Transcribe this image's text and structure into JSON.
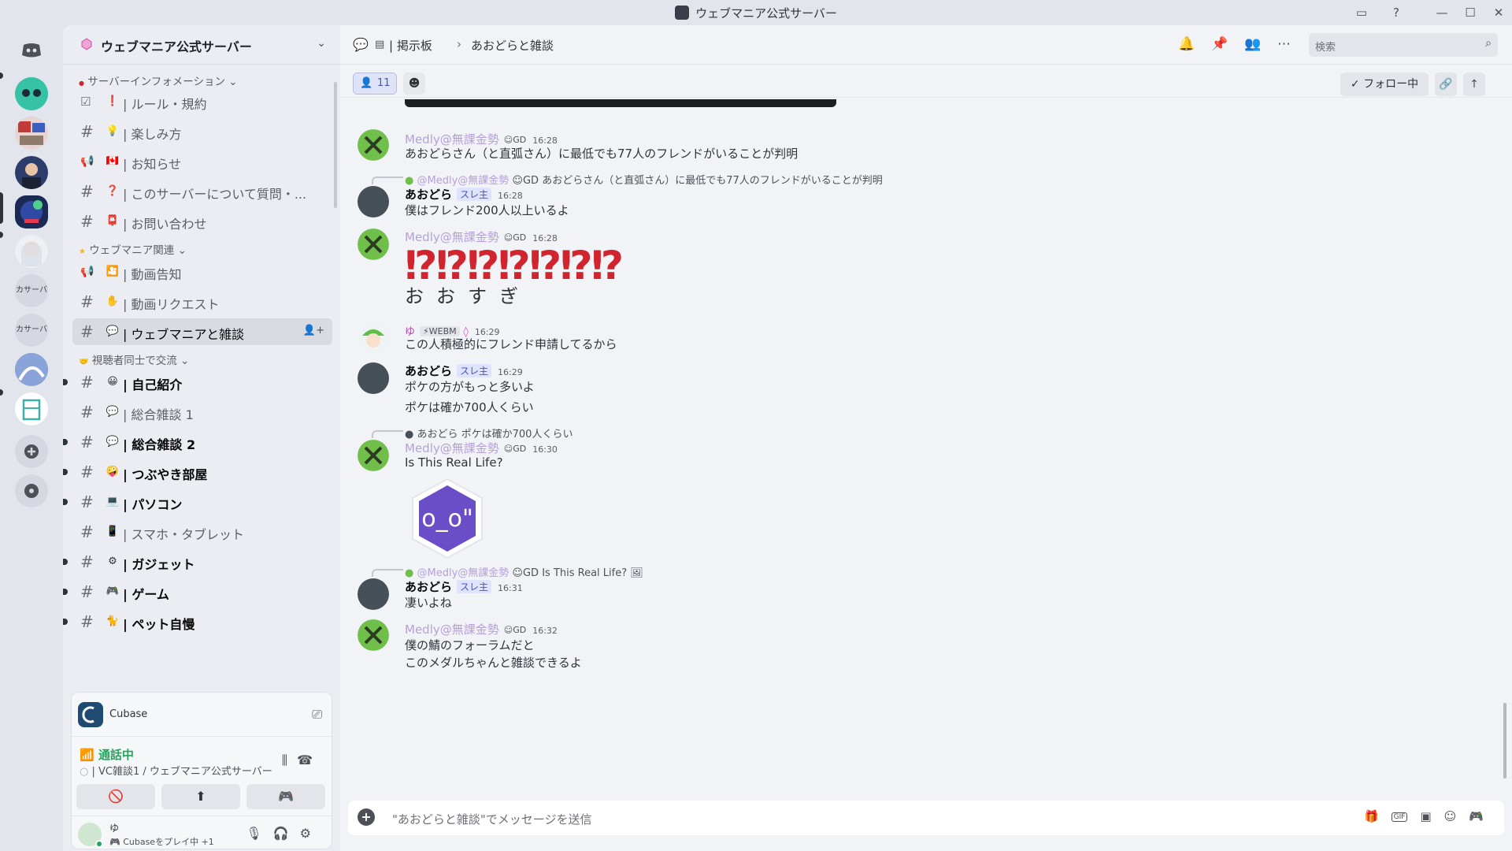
{
  "window": {
    "title": "ウェブマニア公式サーバー"
  },
  "rail": {
    "servers_text": [
      "カサーバ",
      "カサーバ"
    ]
  },
  "sidebar": {
    "server_name": "ウェブマニア公式サーバー",
    "categories": [
      {
        "label": "サーバーインフォメーション"
      },
      {
        "label": "ウェブマニア関連"
      },
      {
        "label": "視聴者同士で交流"
      }
    ],
    "channels": [
      {
        "emoji": "❗",
        "label": "| ルール・規約"
      },
      {
        "emoji": "💡",
        "label": "| 楽しみ方"
      },
      {
        "emoji": "🇨🇦",
        "label": "| お知らせ"
      },
      {
        "emoji": "❓",
        "label": "| このサーバーについて質問・..."
      },
      {
        "emoji": "📮",
        "label": "| お問い合わせ"
      },
      {
        "emoji": "🎦",
        "label": "| 動画告知"
      },
      {
        "emoji": "✋",
        "label": "| 動画リクエスト"
      },
      {
        "emoji": "💬",
        "label": "| ウェブマニアと雑談"
      },
      {
        "emoji": "😀",
        "label": "| 自己紹介"
      },
      {
        "emoji": "💬",
        "label": "| 総合雑談 1"
      },
      {
        "emoji": "💬",
        "label": "| 総合雑談 2"
      },
      {
        "emoji": "🤪",
        "label": "| つぶやき部屋"
      },
      {
        "emoji": "💻",
        "label": "| パソコン"
      },
      {
        "emoji": "📱",
        "label": "| スマホ・タブレット"
      },
      {
        "emoji": "⚙",
        "label": "| ガジェット"
      },
      {
        "emoji": "🎮",
        "label": "| ゲーム"
      },
      {
        "emoji": "🐈",
        "label": "| ペット自慢"
      }
    ]
  },
  "voice": {
    "activity_name": "Cubase",
    "status": "通話中",
    "channel": "| VC雑談1 / ウェブマニア公式サーバー",
    "user_name": "ゆ",
    "user_activity": "Cubaseをプレイ中 +1"
  },
  "header": {
    "forum": "| 掲示板",
    "separator": "›",
    "thread": "あおどらと雑談",
    "search_placeholder": "検索"
  },
  "threadbar": {
    "member_count": "11",
    "follow_label": "フォロー中"
  },
  "messages": {
    "m1": {
      "name": "Medly@無課金勢",
      "tag": "GD",
      "time": "16:28",
      "text": "あおどらさん（と直弧さん）に最低でも77人のフレンドがいることが判明"
    },
    "m2": {
      "reply_name": "@Medly@無課金勢",
      "reply_tag": "GD",
      "reply_text": "あおどらさん（と直弧さん）に最低でも77人のフレンドがいることが判明",
      "name": "あおどら",
      "op": "スレ主",
      "time": "16:28",
      "text": "僕はフレンド200人以上いるよ"
    },
    "m3": {
      "name": "Medly@無課金勢",
      "tag": "GD",
      "time": "16:28",
      "big": "⁉⁉⁉⁉⁉⁉⁉",
      "small": "おおすぎ"
    },
    "m4": {
      "name": "ゆ",
      "tag": "WEBM",
      "time": "16:29",
      "text": "この人積極的にフレンド申請してるから"
    },
    "m5": {
      "name": "あおどら",
      "op": "スレ主",
      "time": "16:29",
      "text1": "ポケの方がもっと多いよ",
      "text2": "ポケは確か700人くらい"
    },
    "m6": {
      "reply_name": "あおどら",
      "reply_text": "ポケは確か700人くらい",
      "name": "Medly@無課金勢",
      "tag": "GD",
      "time": "16:30",
      "text": "Is This Real Life?",
      "sticker_text": "o_o\""
    },
    "m7": {
      "reply_name": "@Medly@無課金勢",
      "reply_tag": "GD",
      "reply_text": "Is This Real Life?",
      "name": "あおどら",
      "op": "スレ主",
      "time": "16:31",
      "text": "凄いよね"
    },
    "m8": {
      "name": "Medly@無課金勢",
      "tag": "GD",
      "time": "16:32",
      "text1": "僕の鯖のフォーラムだと",
      "text2": "このメダルちゃんと雑談できるよ"
    }
  },
  "composer": {
    "placeholder": "\"あおどらと雑談\"でメッセージを送信",
    "gif_label": "GIF"
  },
  "colors": {
    "accent": "#5865f2",
    "online": "#23a55a",
    "big_text": "#d0252f",
    "medly_name": "#b5a0d8"
  }
}
